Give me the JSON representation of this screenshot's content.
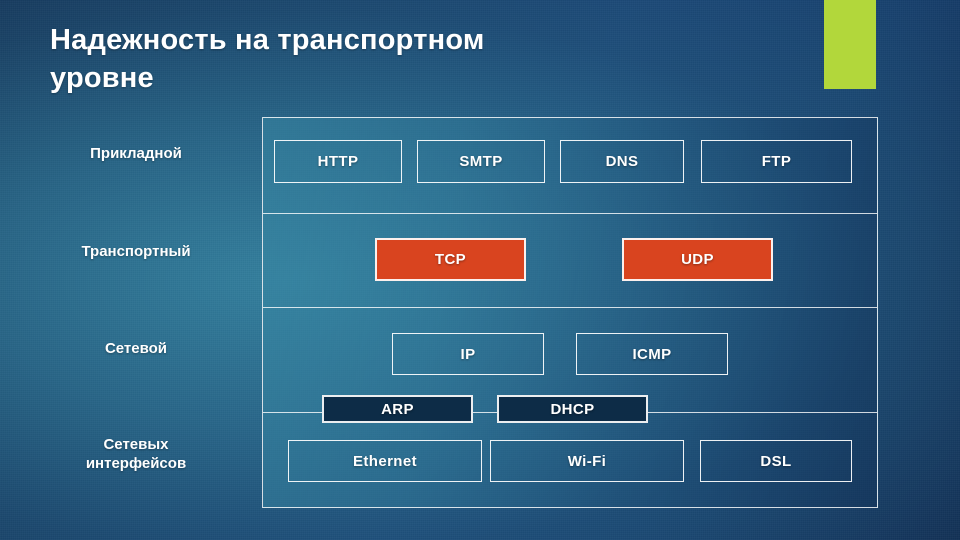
{
  "slide": {
    "title": "Надежность на транспортном\nуровне",
    "accent_color": "#b2d73b",
    "background_color": "#1b4478",
    "diagram_fill_color": "#3f8aa6"
  },
  "diagram": {
    "layer_labels": [
      {
        "name": "application",
        "text": "Прикладной"
      },
      {
        "name": "transport",
        "text": "Транспортный"
      },
      {
        "name": "network",
        "text": "Сетевой"
      },
      {
        "name": "link",
        "text": "Сетевых\nинтерфейсов"
      }
    ],
    "rows": {
      "application": [
        {
          "label": "HTTP",
          "style": "outline"
        },
        {
          "label": "SMTP",
          "style": "outline"
        },
        {
          "label": "DNS",
          "style": "outline"
        },
        {
          "label": "FTP",
          "style": "outline"
        }
      ],
      "transport": [
        {
          "label": "TCP",
          "style": "filled-orange",
          "color": "#d9441f"
        },
        {
          "label": "UDP",
          "style": "filled-orange",
          "color": "#d9441f"
        }
      ],
      "network": [
        {
          "label": "IP",
          "style": "outline"
        },
        {
          "label": "ICMP",
          "style": "outline"
        }
      ],
      "network_straddling": [
        {
          "label": "ARP",
          "style": "filled-navy",
          "color": "#0d2c47"
        },
        {
          "label": "DHCP",
          "style": "filled-navy",
          "color": "#0d2c47"
        }
      ],
      "link": [
        {
          "label": "Ethernet",
          "style": "outline"
        },
        {
          "label": "Wi-Fi",
          "style": "outline"
        },
        {
          "label": "DSL",
          "style": "outline"
        }
      ]
    }
  }
}
